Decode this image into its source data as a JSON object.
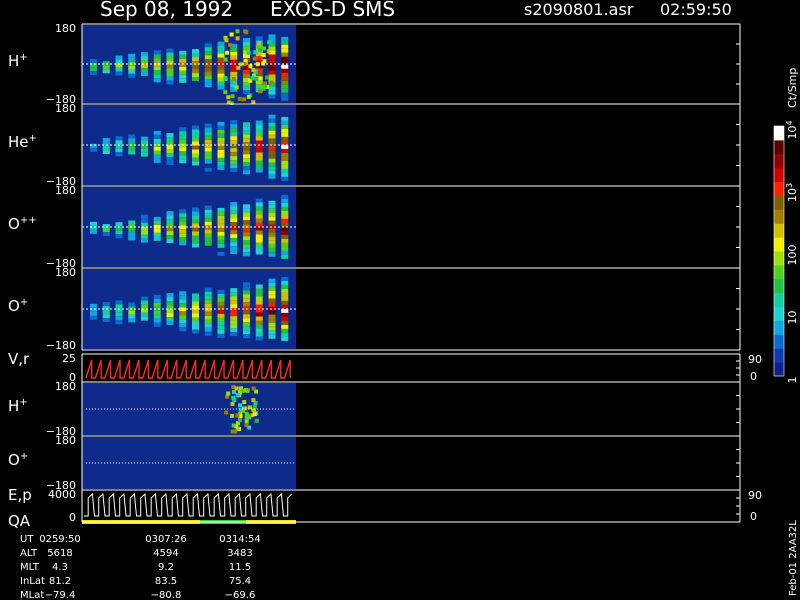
{
  "header": {
    "date": "Sep 08, 1992",
    "instrument": "EXOS-D SMS",
    "file": "s2090801.asr",
    "time": "02:59:50"
  },
  "colors": {
    "background": "#000000",
    "panel": "#0e2a8a",
    "grid": "#ffffff",
    "vr_trace": "#ff2a1a",
    "qa_yellow": "#f2e200",
    "qa_green": "#3ed43e"
  },
  "chart_data": {
    "type": "heatmap",
    "x_range": [
      "0259:50",
      "0314:54"
    ],
    "panels": [
      {
        "id": "h-plus",
        "label_base": "H",
        "label_sup": "+",
        "y_top": "180",
        "y_bottom": "−180",
        "intensity": 1.0,
        "cols": 16,
        "kind": "pitch"
      },
      {
        "id": "he-plus",
        "label_base": "He",
        "label_sup": "+",
        "y_top": "180",
        "y_bottom": "−180",
        "intensity": 0.85,
        "cols": 16,
        "kind": "pitch"
      },
      {
        "id": "o-plusplus",
        "label_base": "O",
        "label_sup": "++",
        "y_top": "180",
        "y_bottom": "−180",
        "intensity": 0.85,
        "cols": 16,
        "kind": "pitch"
      },
      {
        "id": "o-plus",
        "label_base": "O",
        "label_sup": "+",
        "y_top": "180",
        "y_bottom": "−180",
        "intensity": 0.9,
        "cols": 16,
        "kind": "pitch"
      },
      {
        "id": "vr",
        "label_base": "V,r",
        "label_sup": "",
        "y_top": "25",
        "y_bottom": "0",
        "right_top": "90",
        "right_bottom": "0",
        "kind": "vr"
      },
      {
        "id": "h-plus-2",
        "label_base": "H",
        "label_sup": "+",
        "y_top": "180",
        "y_bottom": "−180",
        "kind": "sparse"
      },
      {
        "id": "o-plus-2",
        "label_base": "O",
        "label_sup": "+",
        "y_top": "180",
        "y_bottom": "−180",
        "kind": "sparse2"
      },
      {
        "id": "ep",
        "label_base": "E,p",
        "label_sup": "",
        "label2": "QA",
        "y_top": "4000",
        "y_bottom": "0",
        "right_top": "90",
        "right_bottom": "0",
        "kind": "ep"
      }
    ],
    "colorbar": {
      "unit": "Ct/Smp",
      "ticks": [
        {
          "label": "1",
          "frac": 0.0
        },
        {
          "label": "10",
          "frac": 0.25
        },
        {
          "label": "100",
          "frac": 0.5
        },
        {
          "label": "10",
          "sup": "3",
          "frac": 0.75
        },
        {
          "label": "10",
          "sup": "4",
          "frac": 1.0
        }
      ],
      "colors": [
        "#10208a",
        "#0c3ab0",
        "#0a6ad0",
        "#10a8e0",
        "#22d0d0",
        "#10d0a0",
        "#20c040",
        "#50d020",
        "#a0e010",
        "#f0f000",
        "#d0c000",
        "#a08000",
        "#806000",
        "#ff2000",
        "#d00000",
        "#900000",
        "#600000",
        "#ffffff"
      ]
    },
    "table": {
      "rows": [
        {
          "label": "UT",
          "values": [
            "0259:50",
            "0307:26",
            "0314:54"
          ]
        },
        {
          "label": "ALT",
          "values": [
            "5618",
            "4594",
            "3483"
          ]
        },
        {
          "label": "MLT",
          "values": [
            "4.3",
            "9.2",
            "11.5"
          ]
        },
        {
          "label": "InLat",
          "values": [
            "81.2",
            "83.5",
            "75.4"
          ]
        },
        {
          "label": "MLat",
          "values": [
            "−79.4",
            "−80.8",
            "−69.6"
          ]
        }
      ]
    },
    "footer_note": "Feb-01 2AA32L"
  }
}
